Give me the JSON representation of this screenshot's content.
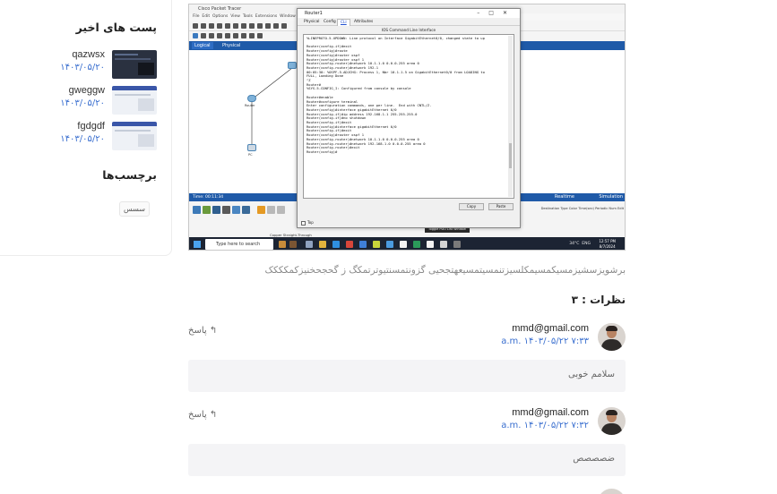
{
  "sidebar": {
    "recent_posts_title": "پست های اخیر",
    "posts": [
      {
        "title": "qazwsx",
        "date": "۱۴۰۳/۰۵/۲۰"
      },
      {
        "title": "gweggw",
        "date": "۱۴۰۳/۰۵/۲۰"
      },
      {
        "title": "fgdgdf",
        "date": "۱۴۰۳/۰۵/۲۰"
      }
    ],
    "tags_title": "برچسب‌ها",
    "tags": [
      "سسس"
    ]
  },
  "screenshot": {
    "app_title": "Cisco Packet Tracer",
    "menu": [
      "File",
      "Edit",
      "Options",
      "View",
      "Tools",
      "Extensions",
      "Window",
      "Help"
    ],
    "logical_label": "Logical",
    "physical_label": "Physical",
    "time_label": "Time: 00:11:34",
    "realtime_label": "Realtime",
    "simulation_label": "Simulation",
    "bottom_columns": "Destination   Type   Color   Time(sec)   Periodic   Num   Edit",
    "copper_label": "Copper Straight-Through",
    "toggle_label": "Toggle PDU List Window",
    "taskbar_search": "Type here to search",
    "weather": "34°C",
    "lang": "ENG",
    "clock_time": "12:57 PM",
    "clock_date": "8/7/2024",
    "router_window": {
      "title": "Router1",
      "tabs": [
        "Physical",
        "Config",
        "CLI",
        "Attributes"
      ],
      "active_tab": "CLI",
      "cli_header": "IOS Command Line Interface",
      "console_lines": [
        "%LINEPROTO-5-UPDOWN: Line protocol on Interface GigabitEthernet0/0, changed state to up",
        "",
        "Router(config-if)#exit",
        "Router(config)#route",
        "Router(config)#router ospf",
        "Router(config)#router ospf 1",
        "Router(config-router)#network 10.1.1.0 0.0.0.255 area 0",
        "Router(config-router)#network 192.1",
        "00:05:30: %OSPF-5-ADJCHG: Process 1, Nbr 10.1.1.5 on GigabitEthernet0/0 from LOADING to",
        "FULL, Loading Done",
        "^Z",
        "Router#",
        "%SYS-5-CONFIG_I: Configured from console by console",
        "",
        "Router#enable",
        "Router#configure terminal",
        "Enter configuration commands, one per line.  End with CNTL/Z.",
        "Router(config)#interface gigabitEthernet 0/0",
        "Router(config-if)#ip address 192.168.1.1 255.255.255.0",
        "Router(config-if)#no shutdown",
        "Router(config-if)#exit",
        "Router(config)#interface gigabitEthernet 0/0",
        "Router(config-if)#exit",
        "Router(config)#router ospf 1",
        "Router(config-router)#network 10.1.1.0 0.0.0.255 area 0",
        "Router(config-router)#network 192.168.1.0 0.0.0.255 area 0",
        "Router(config-router)#exit",
        "Router(config)#"
      ],
      "copy_label": "Copy",
      "paste_label": "Paste",
      "top_label": "Top"
    }
  },
  "post_text": "برشویزسشیزمسیکمسیمکلسیزتنمسیتمسیعهتجحیی گزونتمسنتیوترتمکگ ز گحجحخنیزکمکککک",
  "comments": {
    "title": "نظرات : ۳",
    "reply_label": "پاسخ",
    "items": [
      {
        "author": "mmd@gmail.com",
        "date": "a.m. ۱۴۰۳/۰۵/۲۲ ۷:۳۳",
        "text": "سلامم خوبی"
      },
      {
        "author": "mmd@gmail.com",
        "date": "a.m. ۱۴۰۳/۰۵/۲۲ ۷:۳۲",
        "text": "ضصصصص"
      }
    ]
  }
}
